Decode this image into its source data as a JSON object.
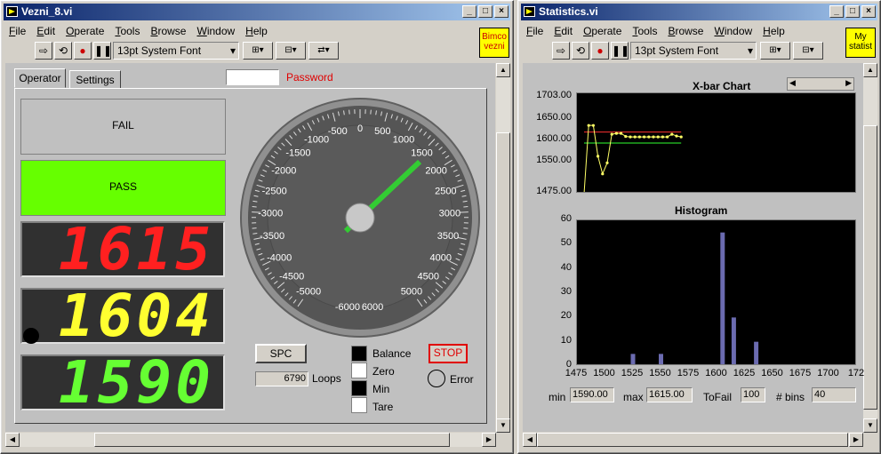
{
  "left_window": {
    "title": "Vezni_8.vi",
    "menu": [
      "File",
      "Edit",
      "Operate",
      "Tools",
      "Browse",
      "Window",
      "Help"
    ],
    "font_select": "13pt System Font",
    "vi_icon_text": "Bimco\nvezni",
    "tabs": [
      "Operator",
      "Settings"
    ],
    "password_label": "Password",
    "password_value": "",
    "fail_label": "FAIL",
    "pass_label": "PASS",
    "pass_color": "#66ff00",
    "display1": "1615",
    "display1_color": "#ff2020",
    "display2": "1604",
    "display2_color": "#ffff30",
    "display3": "1590",
    "display3_color": "#66ff33",
    "gauge": {
      "value": 1615,
      "min": -6000,
      "max": 6000,
      "ticks": [
        "0",
        "500",
        "1000",
        "1500",
        "2000",
        "2500",
        "3000",
        "3500",
        "4000",
        "4500",
        "5000",
        "6000",
        "-6000",
        "-5000",
        "-4500",
        "-4000",
        "-3500",
        "-3000",
        "-2500",
        "-2000",
        "-1500",
        "-1000",
        "-500"
      ]
    },
    "spc_label": "SPC",
    "loops_value": "6790",
    "loops_label": "Loops",
    "stop_label": "STOP",
    "error_label": "Error",
    "indicators": [
      {
        "label": "Balance",
        "state": "on"
      },
      {
        "label": "Zero",
        "state": "off"
      },
      {
        "label": "Min",
        "state": "on"
      },
      {
        "label": "Tare",
        "state": "off"
      }
    ]
  },
  "right_window": {
    "title": "Statistics.vi",
    "menu": [
      "File",
      "Edit",
      "Operate",
      "Tools",
      "Browse",
      "Window",
      "Help"
    ],
    "font_select": "13pt System Font",
    "vi_icon_text": "My\nstatist",
    "xbar_title": "X-bar Chart",
    "xbar_yticks": [
      "1703.00",
      "1650.00",
      "1600.00",
      "1550.00",
      "1475.00"
    ],
    "hist_title": "Histogram",
    "hist_yticks": [
      "60",
      "50",
      "40",
      "30",
      "20",
      "10",
      "0"
    ],
    "hist_xticks": [
      "1475",
      "1500",
      "1525",
      "1550",
      "1575",
      "1600",
      "1625",
      "1650",
      "1675",
      "1700",
      "172"
    ],
    "min_label": "min",
    "min_value": "1590.00",
    "max_label": "max",
    "max_value": "1615.00",
    "tofail_label": "ToFail",
    "tofail_value": "100",
    "bins_label": "# bins",
    "bins_value": "40"
  },
  "chart_data": [
    {
      "type": "line",
      "title": "X-bar Chart",
      "ylim": [
        1475,
        1703
      ],
      "upper_limit": 1615,
      "lower_limit": 1590,
      "limit_colors": [
        "#ff3030",
        "#30ff30"
      ],
      "series": [
        {
          "values": [
            1475,
            1630,
            1630,
            1560,
            1520,
            1545,
            1610,
            1612,
            1612,
            1605,
            1604,
            1604,
            1604,
            1604,
            1604,
            1604,
            1604,
            1604,
            1604,
            1610,
            1606,
            1604
          ]
        }
      ]
    },
    {
      "type": "bar",
      "title": "Histogram",
      "ylim": [
        0,
        60
      ],
      "xlim": [
        1475,
        1725
      ],
      "bars": [
        {
          "x": 1525,
          "value": 5
        },
        {
          "x": 1550,
          "value": 5
        },
        {
          "x": 1605,
          "value": 55
        },
        {
          "x": 1615,
          "value": 20
        },
        {
          "x": 1635,
          "value": 10
        }
      ]
    }
  ]
}
